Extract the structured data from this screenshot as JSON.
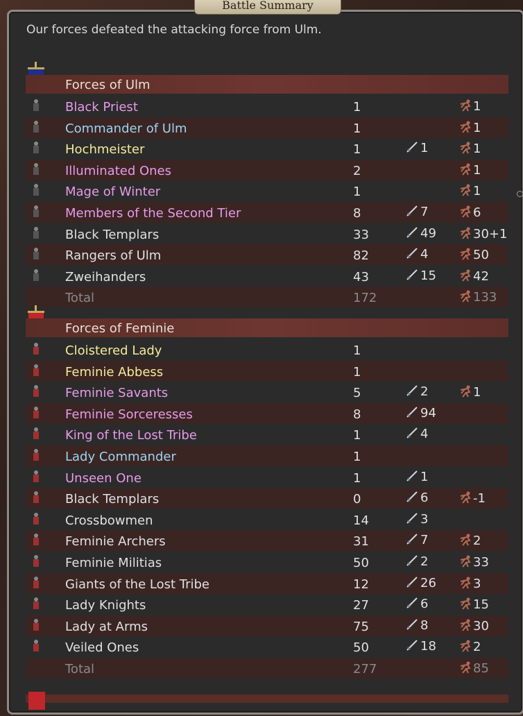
{
  "window": {
    "title": "Battle Summary"
  },
  "message": "Our forces defeated the attacking force from Ulm.",
  "colors": {
    "banner_ulm": "#1e2f8a",
    "banner_feminie": "#c0262a",
    "header_bg": "#6e3630",
    "name_pink": "#e89ae8",
    "name_blue": "#9ad4f0",
    "name_yellow": "#f3eb9a",
    "name_white": "#e0e0e0",
    "total_gray": "#8a8a8a"
  },
  "icons": {
    "kills": "sword-icon",
    "losses": "fallen-soldier-icon"
  },
  "armies": [
    {
      "title": "Forces of Ulm",
      "banner_color": "#1e2f8a",
      "units": [
        {
          "name": "Black Priest",
          "color": "pink",
          "count": "1",
          "kills": "",
          "losses": "1"
        },
        {
          "name": "Commander of Ulm",
          "color": "blue",
          "count": "1",
          "kills": "",
          "losses": "1"
        },
        {
          "name": "Hochmeister",
          "color": "yellow",
          "count": "1",
          "kills": "1",
          "losses": "1"
        },
        {
          "name": "Illuminated Ones",
          "color": "pink",
          "count": "2",
          "kills": "",
          "losses": "1"
        },
        {
          "name": "Mage of Winter",
          "color": "pink",
          "count": "1",
          "kills": "",
          "losses": "1"
        },
        {
          "name": "Members of the Second Tier",
          "color": "pink",
          "count": "8",
          "kills": "7",
          "losses": "6"
        },
        {
          "name": "Black Templars",
          "color": "white",
          "count": "33",
          "kills": "49",
          "losses": "30+1"
        },
        {
          "name": "Rangers of Ulm",
          "color": "white",
          "count": "82",
          "kills": "4",
          "losses": "50"
        },
        {
          "name": "Zweihanders",
          "color": "white",
          "count": "43",
          "kills": "15",
          "losses": "42"
        }
      ],
      "total": {
        "label": "Total",
        "count": "172",
        "losses": "133"
      }
    },
    {
      "title": "Forces of Feminie",
      "banner_color": "#c0262a",
      "units": [
        {
          "name": "Cloistered Lady",
          "color": "yellow",
          "count": "1",
          "kills": "",
          "losses": ""
        },
        {
          "name": "Feminie Abbess",
          "color": "yellow",
          "count": "1",
          "kills": "",
          "losses": ""
        },
        {
          "name": "Feminie Savants",
          "color": "pink",
          "count": "5",
          "kills": "2",
          "losses": "1"
        },
        {
          "name": "Feminie Sorceresses",
          "color": "pink",
          "count": "8",
          "kills": "94",
          "losses": ""
        },
        {
          "name": "King of the Lost Tribe",
          "color": "pink",
          "count": "1",
          "kills": "4",
          "losses": ""
        },
        {
          "name": "Lady Commander",
          "color": "blue",
          "count": "1",
          "kills": "",
          "losses": ""
        },
        {
          "name": "Unseen One",
          "color": "pink",
          "count": "1",
          "kills": "1",
          "losses": ""
        },
        {
          "name": "Black Templars",
          "color": "white",
          "count": "0",
          "kills": "6",
          "losses": "-1"
        },
        {
          "name": "Crossbowmen",
          "color": "white",
          "count": "14",
          "kills": "3",
          "losses": ""
        },
        {
          "name": "Feminie Archers",
          "color": "white",
          "count": "31",
          "kills": "7",
          "losses": "2"
        },
        {
          "name": "Feminie Militias",
          "color": "white",
          "count": "50",
          "kills": "2",
          "losses": "33"
        },
        {
          "name": "Giants of the Lost Tribe",
          "color": "white",
          "count": "12",
          "kills": "26",
          "losses": "3"
        },
        {
          "name": "Lady Knights",
          "color": "white",
          "count": "27",
          "kills": "6",
          "losses": "15"
        },
        {
          "name": "Lady at Arms",
          "color": "white",
          "count": "75",
          "kills": "8",
          "losses": "30"
        },
        {
          "name": "Veiled Ones",
          "color": "white",
          "count": "50",
          "kills": "18",
          "losses": "2"
        }
      ],
      "total": {
        "label": "Total",
        "count": "277",
        "losses": "85"
      }
    }
  ]
}
